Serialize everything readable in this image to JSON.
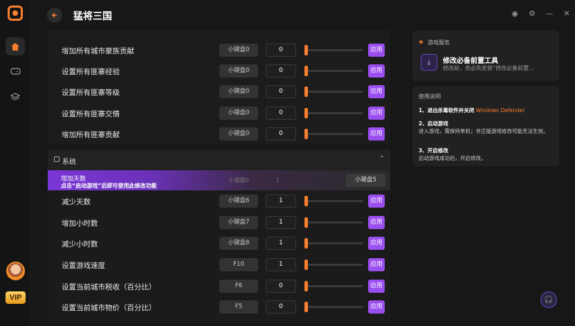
{
  "app": {
    "title": "猛将三国"
  },
  "rows_top": [
    {
      "label": "增加所有城市豪族贡献",
      "key": "小键盘0",
      "value": "0",
      "apply": "应用"
    },
    {
      "label": "设置所有匪寨经验",
      "key": "小键盘0",
      "value": "0",
      "apply": "应用"
    },
    {
      "label": "设置所有匪寨等级",
      "key": "小键盘0",
      "value": "0",
      "apply": "应用"
    },
    {
      "label": "设置所有匪寨交情",
      "key": "小键盘0",
      "value": "0",
      "apply": "应用"
    },
    {
      "label": "增加所有匪寨贡献",
      "key": "小键盘0",
      "value": "0",
      "apply": "应用"
    }
  ],
  "system_section": {
    "title": "系统"
  },
  "highlight_row": {
    "title": "增加天数",
    "notice": "点击“启动游戏”后即可使用此修改功能",
    "ghost_key": "小键盘0",
    "ghost_value": "1",
    "key": "小键盘5"
  },
  "rows_system": [
    {
      "label": "减少天数",
      "key": "小键盘6",
      "value": "1",
      "apply": "应用"
    },
    {
      "label": "增加小时数",
      "key": "小键盘7",
      "value": "1",
      "apply": "应用"
    },
    {
      "label": "减少小时数",
      "key": "小键盘8",
      "value": "1",
      "apply": "应用"
    },
    {
      "label": "设置游戏速度",
      "key": "F10",
      "value": "1",
      "apply": "应用"
    },
    {
      "label": "设置当前城市税收（百分比）",
      "key": "F6",
      "value": "0",
      "apply": "应用"
    },
    {
      "label": "设置当前城市物价（百分比）",
      "key": "F5",
      "value": "0",
      "apply": "应用"
    }
  ],
  "game_service": {
    "title": "游戏服务",
    "tool_name": "修改必备前置工具",
    "tool_desc": "修改前，务必先安装“修改必备前置..."
  },
  "instructions": {
    "title": "使用说明",
    "step1_title": "1、退出杀毒软件并关闭",
    "step1_highlight": "Windows Defender",
    "step2_title": "2、启动游戏",
    "step2_text": "进入游戏，需保持单机；非正版游戏修改可能无法生效。",
    "step3_title": "3、开启修改",
    "step3_text": "启动游戏成功后，开启修改。"
  },
  "vip_label": "VIP",
  "colors": {
    "accent": "#f97f2e",
    "purple": "#9b4ff0",
    "bg": "#171717"
  }
}
